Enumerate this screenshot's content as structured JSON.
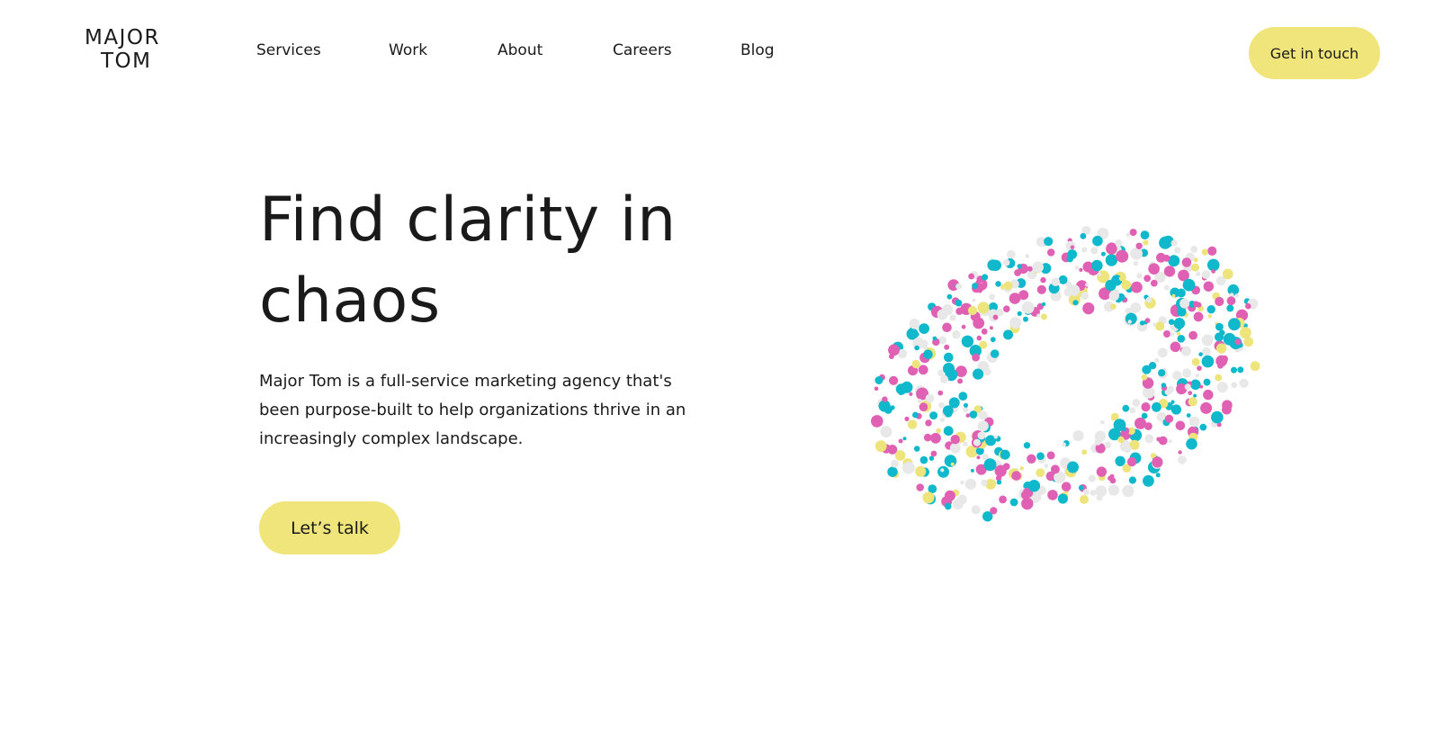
{
  "brand": {
    "logo_line1": "MAJOR",
    "logo_line2": "TOM"
  },
  "nav": {
    "items": [
      {
        "label": "Services"
      },
      {
        "label": "Work"
      },
      {
        "label": "About"
      },
      {
        "label": "Careers"
      },
      {
        "label": "Blog"
      }
    ]
  },
  "header": {
    "cta_label": "Get in touch"
  },
  "hero": {
    "headline": "Find clarity in chaos",
    "body": "Major Tom is a full-service marketing agency that's been purpose-built to help organizations thrive in an increasingly complex landscape.",
    "cta_label": "Let’s talk"
  },
  "colors": {
    "accent": "#efe57a",
    "text": "#1a1a1a",
    "dot_pink": "#e060b4",
    "dot_cyan": "#10b8cc",
    "dot_yellow": "#ede47c",
    "dot_grey": "#e8e8e8"
  }
}
